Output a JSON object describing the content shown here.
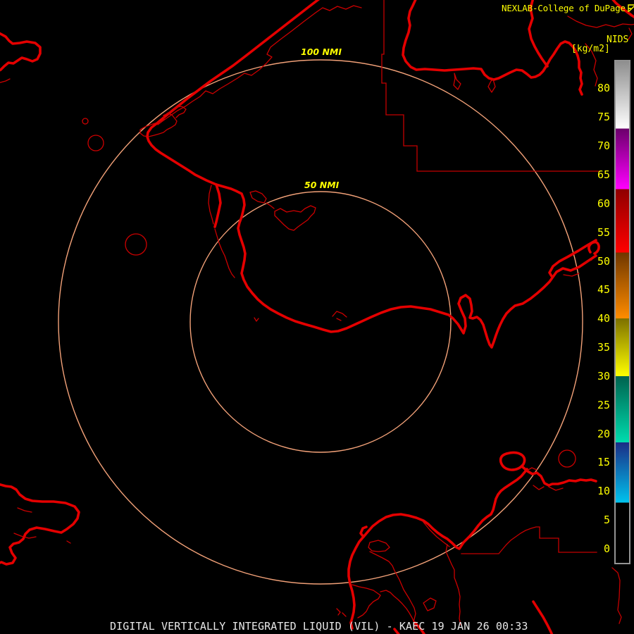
{
  "header": {
    "brand": "NEXLAB-College of DuPage"
  },
  "scale": {
    "title": "NIDS",
    "units": "[kg/m2]",
    "tick_values": [
      0,
      5,
      10,
      15,
      20,
      25,
      30,
      35,
      40,
      45,
      50,
      55,
      60,
      65,
      70,
      75,
      80
    ],
    "value_range": [
      0,
      85
    ],
    "segments": [
      {
        "from": 73,
        "to": 85,
        "color_top": "#8E8E8E",
        "color_bottom": "#FFFFFF"
      },
      {
        "from": 62.5,
        "to": 73,
        "color_top": "#6B006B",
        "color_bottom": "#FF00FF"
      },
      {
        "from": 51.5,
        "to": 62.5,
        "color_top": "#8F0000",
        "color_bottom": "#FF0000"
      },
      {
        "from": 40,
        "to": 51.5,
        "color_top": "#6E3600",
        "color_bottom": "#FF8C00"
      },
      {
        "from": 30,
        "to": 40,
        "color_top": "#7D7000",
        "color_bottom": "#FFFF00"
      },
      {
        "from": 18.5,
        "to": 30,
        "color_top": "#00624E",
        "color_bottom": "#00DCAE"
      },
      {
        "from": 8,
        "to": 18.5,
        "color_top": "#1B2C85",
        "color_bottom": "#00C3EE"
      },
      {
        "from": 0,
        "to": 8,
        "color_top": "#000000",
        "color_bottom": "#000000"
      }
    ]
  },
  "map": {
    "range_rings": [
      {
        "label": "100 NMI",
        "radius_nmi": 100
      },
      {
        "label": "50 NMI",
        "radius_nmi": 50
      }
    ]
  },
  "caption": {
    "text": "DIGITAL VERTICALLY INTEGRATED LIQUID (VIL) - KAEC 19 JAN 26 00:33",
    "product": "DIGITAL VERTICALLY INTEGRATED LIQUID (VIL)",
    "station": "KAEC",
    "datetime": "19 JAN 26 00:33"
  },
  "colors": {
    "background": "#000000",
    "outline_thick": "#E40000",
    "outline_thin": "#CC0000",
    "boundary": "#C40000",
    "range_ring": "#F2A178",
    "label_yellow": "#FFFF00",
    "caption_white": "#E8E8E8"
  }
}
